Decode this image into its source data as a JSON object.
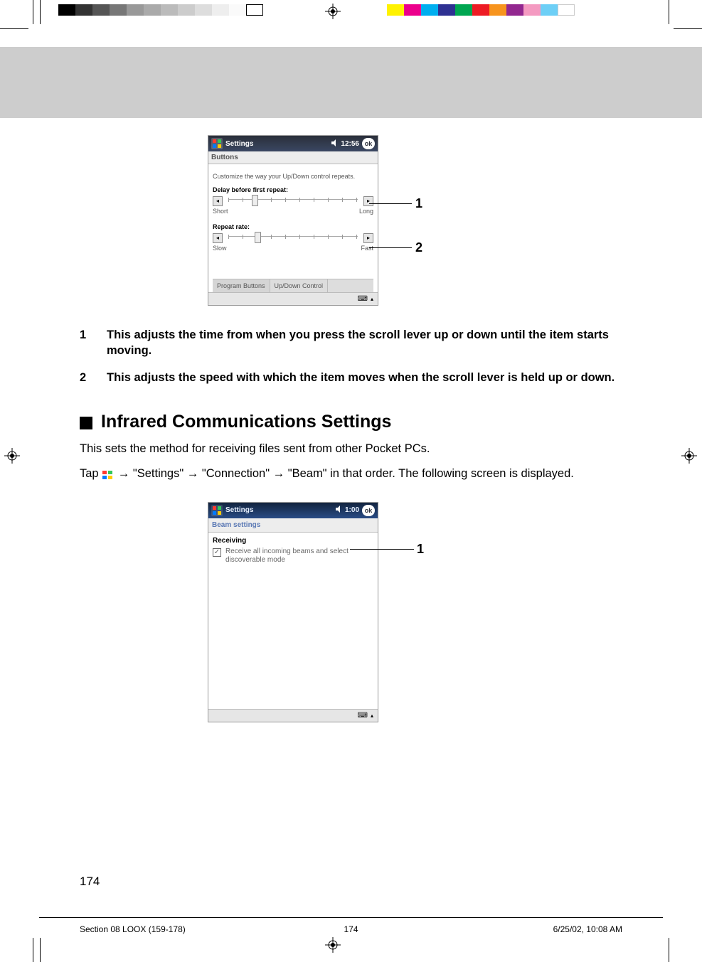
{
  "print": {
    "grayscale": [
      "#000000",
      "#333333",
      "#555555",
      "#777777",
      "#999999",
      "#aaaaaa",
      "#bbbbbb",
      "#cccccc",
      "#dddddd",
      "#ffffff"
    ],
    "colors": [
      "#fff200",
      "#ec008c",
      "#00aeef",
      "#2e3192",
      "#00a651",
      "#ed1c24",
      "#f7941d",
      "#92278f",
      "#f49ac1",
      "#6dcff6"
    ]
  },
  "screenshot1": {
    "titlebar": "Settings",
    "time": "12:56",
    "ok": "ok",
    "heading": "Buttons",
    "desc": "Customize the way your Up/Down control repeats.",
    "slider1": {
      "label": "Delay before first repeat:",
      "left": "Short",
      "right": "Long"
    },
    "slider2": {
      "label": "Repeat rate:",
      "left": "Slow",
      "right": "Fast"
    },
    "tabs": {
      "a": "Program Buttons",
      "b": "Up/Down Control"
    }
  },
  "explain": {
    "n1": "1",
    "t1": "This adjusts the time from when you press the scroll lever up or down until the item starts moving.",
    "n2": "2",
    "t2": "This adjusts the speed with which the item moves when the scroll lever is held up or down."
  },
  "section": {
    "title": "Infrared Communications Settings"
  },
  "body": {
    "p1": "This sets the method for receiving files sent from other Pocket PCs.",
    "p2a": "Tap ",
    "p2b": " → \"Settings\" → \"Connection\" → \"Beam\" in that order. The following screen is displayed."
  },
  "screenshot2": {
    "titlebar": "Settings",
    "time": "1:00",
    "ok": "ok",
    "heading": "Beam settings",
    "sublabel": "Receiving",
    "checkbox": "Receive all incoming beams and select discoverable mode"
  },
  "page_num": "174",
  "footer": {
    "left": "Section 08 LOOX (159-178)",
    "mid": "174",
    "right": "6/25/02, 10:08 AM"
  },
  "callouts": {
    "s1a": "1",
    "s1b": "2",
    "s2a": "1"
  }
}
